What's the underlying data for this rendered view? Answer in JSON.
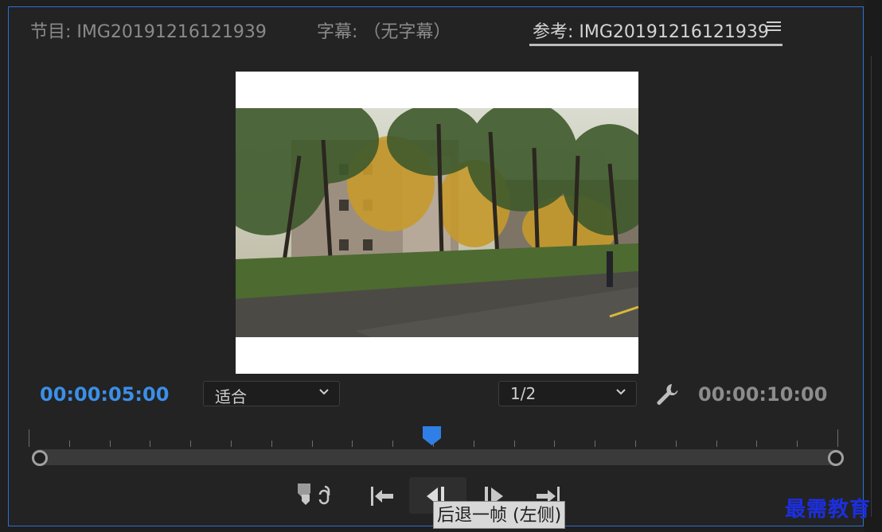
{
  "tabs": [
    {
      "label": "节目: IMG20191216121939",
      "active": false
    },
    {
      "label": "字幕: （无字幕）",
      "active": false
    },
    {
      "label": "参考: IMG20191216121939",
      "active": true
    }
  ],
  "panel_menu_icon": "hamburger-menu-icon",
  "timecode_current": "00:00:05:00",
  "timecode_duration": "00:00:10:00",
  "zoom_select": {
    "value": "适合"
  },
  "resolution_select": {
    "value": "1/2"
  },
  "settings_icon": "wrench-icon",
  "playhead_position": 0.5,
  "transport_buttons": [
    {
      "name": "add-marker-button",
      "icon": "marker-icon"
    },
    {
      "name": "linked-button",
      "icon": "link-icon"
    },
    {
      "name": "go-to-in-button",
      "icon": "go-to-in-icon"
    },
    {
      "name": "step-back-button",
      "icon": "step-back-icon"
    },
    {
      "name": "step-forward-button",
      "icon": "step-forward-icon"
    },
    {
      "name": "go-to-out-button",
      "icon": "go-to-out-icon"
    }
  ],
  "tooltip": "后退一帧 (左侧)",
  "watermark": "最需教育",
  "colors": {
    "accent": "#3b8fe8",
    "panel_border": "#2d6fd0",
    "background": "#232323"
  }
}
